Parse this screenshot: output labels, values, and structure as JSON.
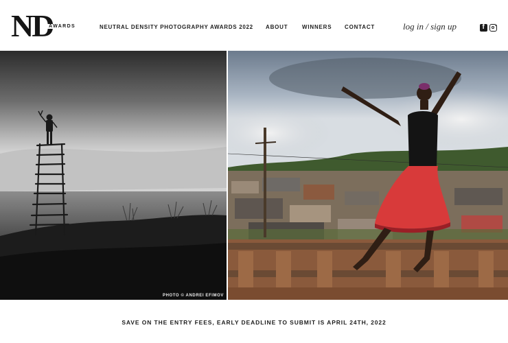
{
  "brand": {
    "logo_text": "ND",
    "logo_sub": "AWARDS"
  },
  "header": {
    "title": "NEUTRAL DENSITY PHOTOGRAPHY AWARDS 2022",
    "nav": [
      {
        "label": "ABOUT"
      },
      {
        "label": "WINNERS"
      },
      {
        "label": "CONTACT"
      }
    ],
    "login": "log in / sign up",
    "social": [
      {
        "icon": "facebook-icon"
      },
      {
        "icon": "instagram-icon"
      }
    ]
  },
  "hero": {
    "left_photo": {
      "credit": "PHOTO © ANDREI EFIMOV"
    },
    "right_photo": {}
  },
  "banner": {
    "text": "SAVE ON THE ENTRY FEES, EARLY DEADLINE TO SUBMIT IS APRIL 24TH, 2022"
  }
}
